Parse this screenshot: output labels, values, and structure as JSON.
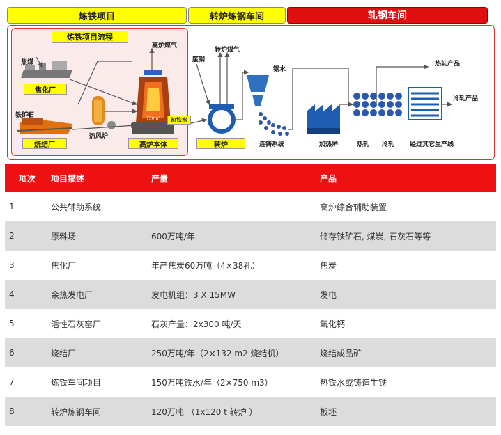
{
  "tabs": {
    "ironmaking": "炼铁项目",
    "steelmaking": "转炉炼钢车间",
    "rolling": "轧钢车间"
  },
  "diagram": {
    "ironmaking_flow_title": "炼铁项目流程",
    "coking_coal": "焦煤",
    "coking_plant": "焦化厂",
    "iron_ore": "铁矿石",
    "sinter_plant": "烧结厂",
    "hot_blast_stove": "热风炉",
    "blast_furnace_gas": "高炉煤气",
    "blast_furnace_body": "高炉本体",
    "hot_metal": "热铁水",
    "scrap_steel": "废钢",
    "converter_gas": "转炉煤气",
    "converter": "转炉",
    "molten_steel": "钢水",
    "continuous_casting": "连铸系统",
    "reheating_furnace": "加热炉",
    "hot_rolling": "热轧",
    "cold_rolling": "冷轧",
    "other_lines": "经过其它生产线",
    "hot_rolled_product": "热轧产品",
    "cold_rolled_product": "冷轧产品"
  },
  "table": {
    "headers": [
      "项次",
      "项目描述",
      "产量",
      "产品"
    ],
    "rows": [
      [
        "1",
        "公共辅助系统",
        "",
        "高炉综合辅助装置"
      ],
      [
        "2",
        "原料场",
        "600万吨/年",
        "储存铁矿石, 煤炭, 石灰石等等"
      ],
      [
        "3",
        "焦化厂",
        "年产焦炭60万吨（4×38孔）",
        "焦炭"
      ],
      [
        "4",
        "余热发电厂",
        "发电机组：3 X 15MW",
        "发电"
      ],
      [
        "5",
        "活性石灰窑厂",
        "石灰产量：2x300 吨/天",
        "氧化钙"
      ],
      [
        "6",
        "烧结厂",
        "250万吨/年（2×132 m2 烧结机）",
        "烧结成品矿"
      ],
      [
        "7",
        "炼铁车间项目",
        "150万吨铁水/年（2×750 m3）",
        "热铁水或铸造生铁"
      ],
      [
        "8",
        "转炉炼钢车间",
        "120万吨 （1x120 t 转炉 ）",
        "板坯"
      ]
    ]
  }
}
